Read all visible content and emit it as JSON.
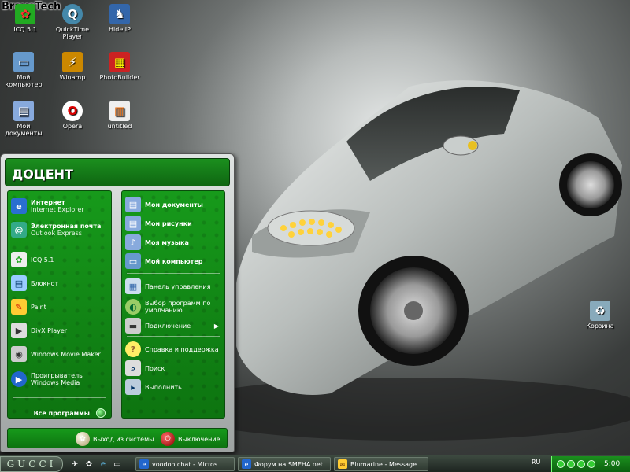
{
  "brand": "BraveTech",
  "desktop_icons": [
    {
      "label": "ICQ 5.1",
      "glyph": "✿",
      "icon": "icq-icon"
    },
    {
      "label": "QuickTime Player",
      "glyph": "Q",
      "icon": "quicktime-icon"
    },
    {
      "label": "Hide IP",
      "glyph": "♞",
      "icon": "hide-ip-icon"
    },
    {
      "label": "Мой компьютер",
      "glyph": "▭",
      "icon": "my-computer-icon"
    },
    {
      "label": "Winamp",
      "glyph": "⚡",
      "icon": "winamp-icon"
    },
    {
      "label": "PhotoBuilder",
      "glyph": "▦",
      "icon": "photobuilder-icon"
    },
    {
      "label": "Мои документы",
      "glyph": "▤",
      "icon": "my-documents-icon"
    },
    {
      "label": "Opera",
      "glyph": "O",
      "icon": "opera-icon"
    },
    {
      "label": "untitled",
      "glyph": "▥",
      "icon": "untitled-file-icon"
    },
    {
      "label": "Корзина",
      "glyph": "♻",
      "icon": "recycle-bin-icon"
    }
  ],
  "start_menu": {
    "user_name": "ДОЦЕНТ",
    "pinned": [
      {
        "title": "Интернет",
        "subtitle": "Internet Explorer",
        "glyph": "e"
      },
      {
        "title": "Электронная почта",
        "subtitle": "Outlook Express",
        "glyph": "@"
      }
    ],
    "recent": [
      {
        "label": "ICQ 5.1",
        "glyph": "✿"
      },
      {
        "label": "Блокнот",
        "glyph": "▤"
      },
      {
        "label": "Paint",
        "glyph": "✎"
      },
      {
        "label": "DivX Player",
        "glyph": "▶"
      },
      {
        "label": "Windows Movie Maker",
        "glyph": "◉"
      },
      {
        "label": "Проигрыватель Windows Media",
        "glyph": "▶"
      }
    ],
    "all_programs": "Все программы",
    "places": [
      {
        "label": "Мои документы",
        "glyph": "▤"
      },
      {
        "label": "Мои рисунки",
        "glyph": "▤"
      },
      {
        "label": "Моя музыка",
        "glyph": "♪"
      },
      {
        "label": "Мой компьютер",
        "glyph": "▭"
      }
    ],
    "system": [
      {
        "label": "Панель управления",
        "glyph": "▦"
      },
      {
        "label": "Выбор программ по умолчанию",
        "glyph": "◐"
      },
      {
        "label": "Подключение",
        "glyph": "▬"
      }
    ],
    "help": [
      {
        "label": "Справка и поддержка",
        "glyph": "?"
      },
      {
        "label": "Поиск",
        "glyph": "⌕"
      },
      {
        "label": "Выполнить...",
        "glyph": "▸"
      }
    ],
    "logoff": "Выход из системы",
    "shutdown": "Выключение"
  },
  "taskbar": {
    "start_label": "GUCCI",
    "tasks": [
      {
        "label": "voodoo chat - Micros...",
        "glyph": "e"
      },
      {
        "label": "Форум на SMEHA.net...",
        "glyph": "e"
      },
      {
        "label": "Blumarine - Message",
        "glyph": "✉"
      }
    ],
    "language": "RU",
    "clock": "5:00"
  }
}
